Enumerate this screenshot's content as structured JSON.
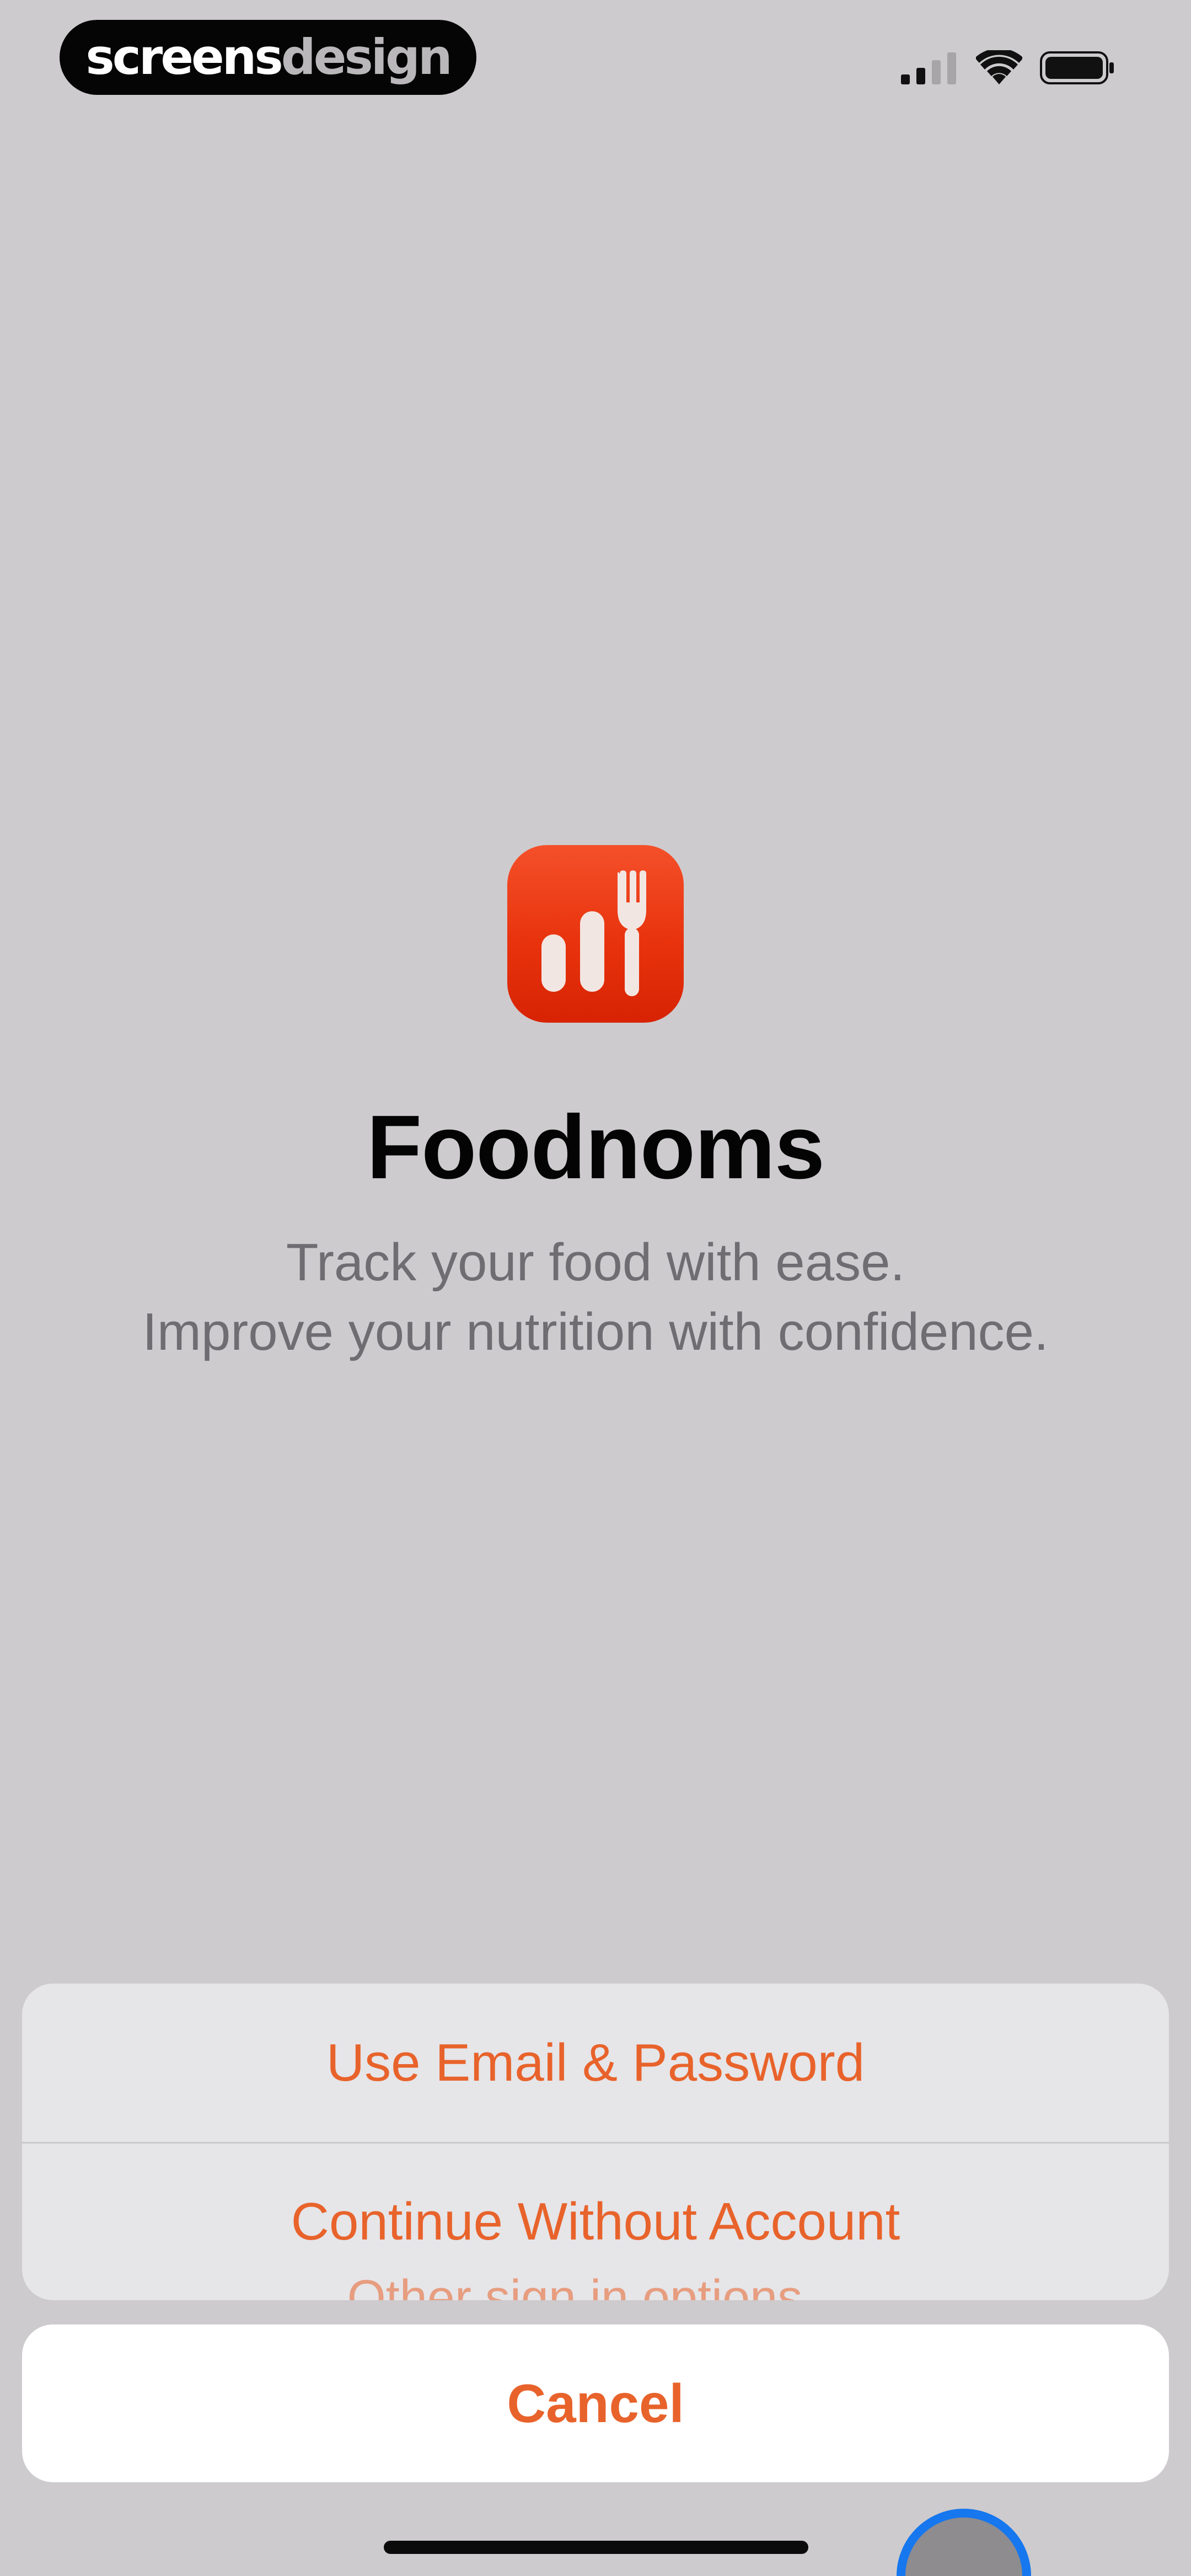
{
  "watermark": {
    "part1": "screens",
    "part2": "design"
  },
  "status_bar": {
    "icons": [
      "signal-icon",
      "wifi-icon",
      "battery-icon"
    ]
  },
  "app": {
    "name": "Foodnoms",
    "tagline_line1": "Track your food with ease.",
    "tagline_line2": "Improve your nutrition with confidence.",
    "icon": "foodnoms-app-icon",
    "accent_color": "#e8632b"
  },
  "action_sheet": {
    "options": [
      {
        "label": "Use Email & Password"
      },
      {
        "label": "Continue Without Account"
      }
    ],
    "partially_hidden_label": "Other sign in options...",
    "cancel_label": "Cancel"
  }
}
